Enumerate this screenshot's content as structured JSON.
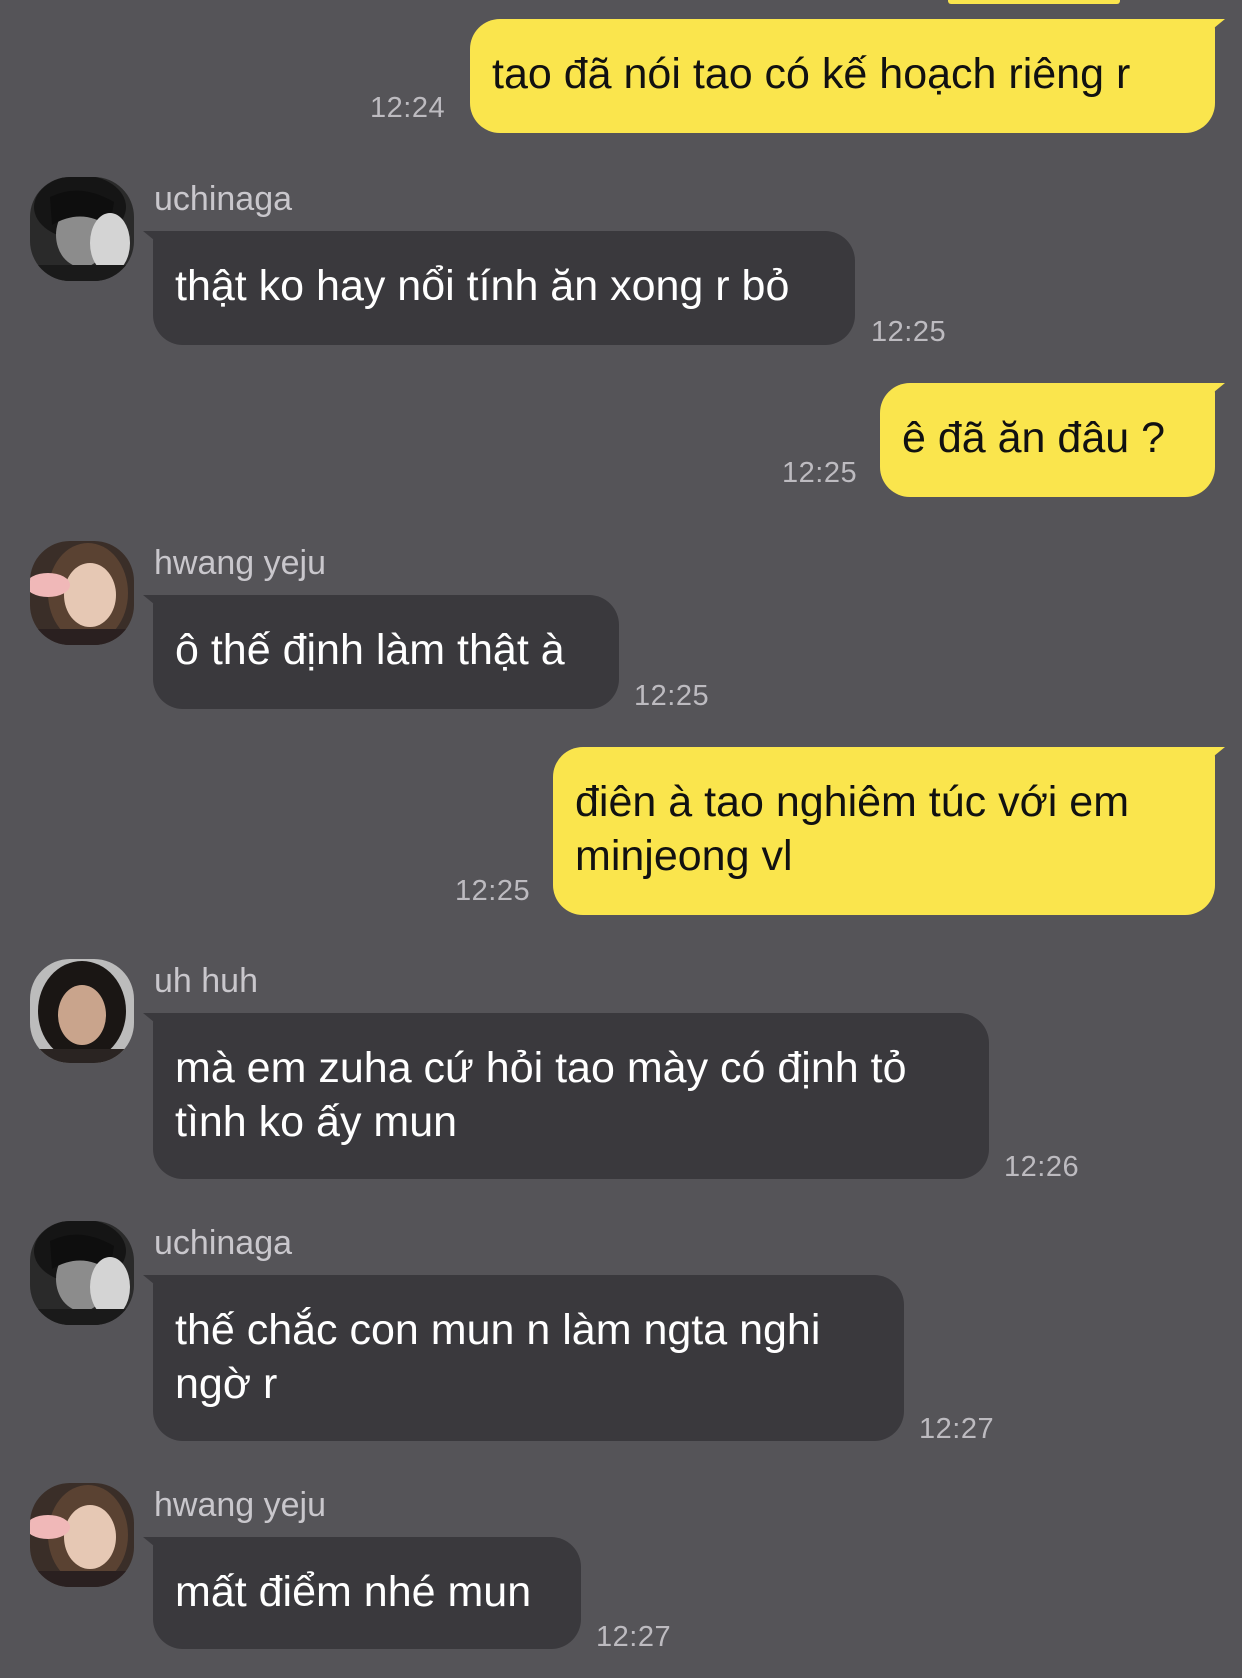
{
  "theme": {
    "background": "#555458",
    "outgoing_bubble": "#FAE54D",
    "incoming_bubble": "#3A393D"
  },
  "messages": [
    {
      "direction": "outgoing",
      "text_lines": [
        "tao đã nói tao có kế hoạch riêng r"
      ],
      "time": "12:24"
    },
    {
      "direction": "incoming",
      "sender": "uchinaga",
      "avatar_icon": "avatar-uchinaga-icon",
      "text_lines": [
        "thật ko hay nổi tính ăn xong r bỏ"
      ],
      "time": "12:25"
    },
    {
      "direction": "outgoing",
      "text_lines": [
        "ê đã ăn đâu ?"
      ],
      "time": "12:25"
    },
    {
      "direction": "incoming",
      "sender": "hwang yeju",
      "avatar_icon": "avatar-hwang-yeju-icon",
      "text_lines": [
        "ô thế định làm thật à"
      ],
      "time": "12:25"
    },
    {
      "direction": "outgoing",
      "text_lines": [
        "điên à tao nghiêm túc với em",
        "minjeong vl"
      ],
      "time": "12:25"
    },
    {
      "direction": "incoming",
      "sender": "uh huh",
      "avatar_icon": "avatar-uh-huh-icon",
      "text_lines": [
        "mà em zuha cứ hỏi tao mày có định tỏ",
        "tình ko ấy mun"
      ],
      "time": "12:26"
    },
    {
      "direction": "incoming",
      "sender": "uchinaga",
      "avatar_icon": "avatar-uchinaga-icon",
      "text_lines": [
        "thế chắc con mun n làm ngta nghi",
        "ngờ r"
      ],
      "time": "12:27"
    },
    {
      "direction": "incoming",
      "sender": "hwang yeju",
      "avatar_icon": "avatar-hwang-yeju-icon",
      "text_lines": [
        "mất điểm nhé mun"
      ],
      "time": "12:27"
    }
  ]
}
